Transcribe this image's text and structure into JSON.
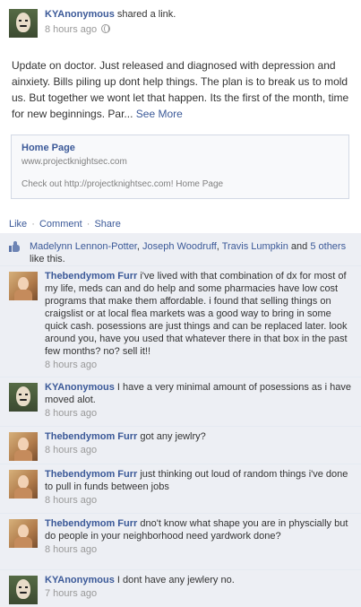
{
  "post": {
    "author": "KYAnonymous",
    "action": "shared a link.",
    "time": "8 hours ago",
    "message": "Update on doctor. Just released and diagnosed with depression and ainxiety. Bills piling up dont help things. The plan is to break us to mold us. But together we wont let that happen. Its the first of the month, time for new beginnings. Par...",
    "see_more": "See More"
  },
  "link_card": {
    "title": "Home Page",
    "url": "www.projectknightsec.com",
    "description": "Check out http://projectknightsec.com! Home Page"
  },
  "actions": {
    "like": "Like",
    "comment": "Comment",
    "share": "Share",
    "separator": "·"
  },
  "likes": {
    "name1": "Madelynn Lennon-Potter",
    "name2": "Joseph Woodruff",
    "name3": "Travis Lumpkin",
    "and": "and",
    "others": "5 others",
    "suffix": "like this."
  },
  "comments": [
    {
      "author": "Thebendymom Furr",
      "text": "i've lived with that combination of dx for most of my life, meds can and do help and some pharmacies have low cost programs that make them affordable. i found that selling things on craigslist or at local flea markets was a good way to bring in some quick cash. posessions are just things and can be replaced later. look around you, have you used that whatever there in that box in the past few months? no? sell it!!",
      "time": "8 hours ago"
    },
    {
      "author": "KYAnonymous",
      "text": "I have a very minimal amount of posessions as i have moved alot.",
      "time": "8 hours ago"
    },
    {
      "author": "Thebendymom Furr",
      "text": "got any jewlry?",
      "time": "8 hours ago"
    },
    {
      "author": "Thebendymom Furr",
      "text": "just thinking out loud of random things i've done to pull in funds between jobs",
      "time": "8 hours ago"
    },
    {
      "author": "Thebendymom Furr",
      "text": "dno't know what shape you are in physcially but do people in your neighborhood need yardwork done?",
      "time": "8 hours ago"
    },
    {
      "author": "KYAnonymous",
      "text": "I dont have any jewlery no.",
      "time": "7 hours ago"
    }
  ]
}
